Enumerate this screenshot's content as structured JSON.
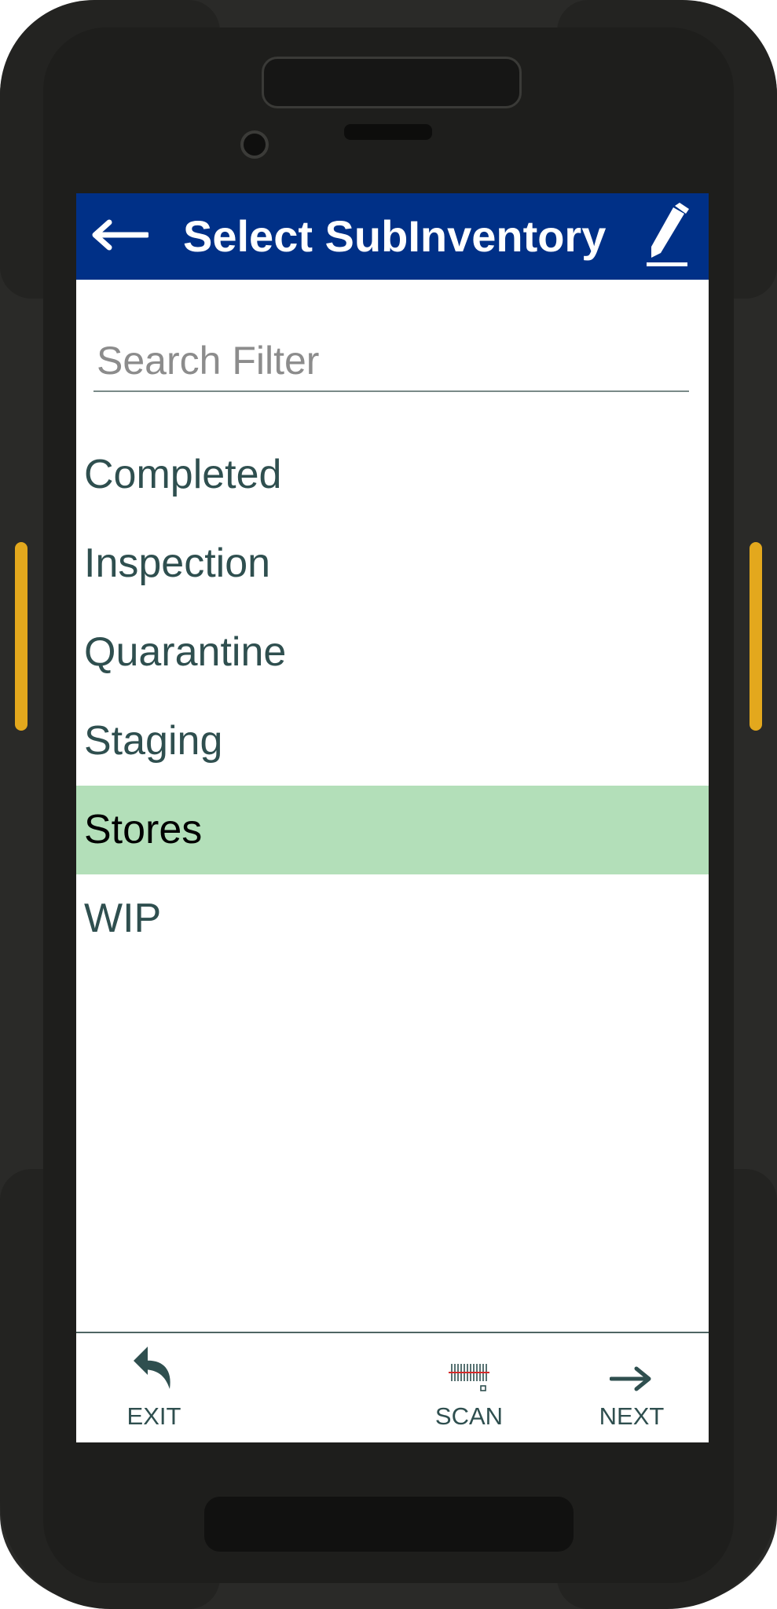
{
  "header": {
    "title": "Select SubInventory",
    "back_icon": "arrow-left-icon",
    "edit_icon": "pencil-icon",
    "background_color": "#003087"
  },
  "search": {
    "placeholder": "Search Filter",
    "value": ""
  },
  "subinventories": [
    {
      "label": "Completed",
      "selected": false
    },
    {
      "label": "Inspection",
      "selected": false
    },
    {
      "label": "Quarantine",
      "selected": false
    },
    {
      "label": "Staging",
      "selected": false
    },
    {
      "label": "Stores",
      "selected": true
    },
    {
      "label": "WIP",
      "selected": false
    }
  ],
  "selection_color": "#b3dfb9",
  "footer": {
    "exit_label": "EXIT",
    "scan_label": "SCAN",
    "next_label": "NEXT",
    "exit_icon": "undo-arrow-icon",
    "scan_icon": "barcode-icon",
    "next_icon": "arrow-right-icon"
  }
}
